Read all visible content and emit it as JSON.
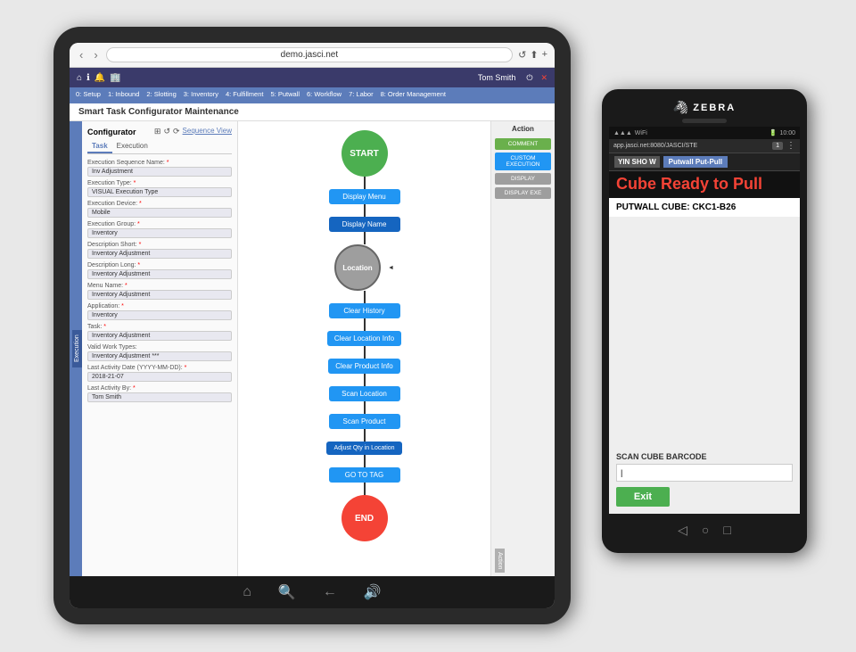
{
  "tablet": {
    "url": "demo.jasci.net",
    "nav_back": "‹",
    "nav_forward": "›",
    "refresh": "↺",
    "share_icon": "⬆",
    "add_icon": "+",
    "user": "Tom Smith",
    "menu_items": [
      "0: Setup",
      "1: Inbound",
      "2: Slotting",
      "3: Inventory",
      "4: Fulfillment",
      "5: Putwall",
      "6: Workflow",
      "7: Labor",
      "8: Order Management"
    ],
    "page_title": "Smart Task Configurator Maintenance",
    "configurator_label": "Configurator",
    "seq_view": "Sequence View",
    "tabs": [
      "Task",
      "Execution"
    ],
    "action_panel_title": "Action",
    "action_buttons": [
      "COMMENT",
      "CUSTOM EXECUTION",
      "DISPLAY",
      "DISPLAY EXE"
    ],
    "side_tab_action": "Action",
    "fields": [
      {
        "label": "Execution Sequence Name:",
        "value": "Inv Adjustment",
        "required": true
      },
      {
        "label": "Execution Type:",
        "value": "VISUAL Execution Type",
        "required": true
      },
      {
        "label": "Execution Device:",
        "value": "Mobile",
        "required": true
      },
      {
        "label": "Execution Group:",
        "value": "Inventory",
        "required": true
      },
      {
        "label": "Description Short:",
        "value": "Inventory Adjustment",
        "required": true
      },
      {
        "label": "Description Long:",
        "value": "Inventory Adjustment",
        "required": true
      },
      {
        "label": "Menu Name:",
        "value": "Inventory Adjustment",
        "required": true
      },
      {
        "label": "Application:",
        "value": "Inventory",
        "required": true
      },
      {
        "label": "Task:",
        "value": "Inventory Adjustment",
        "required": true
      },
      {
        "label": "Valid Work Types:",
        "value": "Inventory Adjustment ***",
        "required": false
      },
      {
        "label": "Last Activity Date (YYYY-MM-DD):",
        "value": "2018-21-07",
        "required": true
      },
      {
        "label": "Last Activity By:",
        "value": "Tom Smith",
        "required": true
      }
    ],
    "flow_nodes": [
      {
        "type": "start",
        "label": "START"
      },
      {
        "type": "box_blue",
        "label": "Display Menu"
      },
      {
        "type": "box_blue2",
        "label": "Display Name"
      },
      {
        "type": "circle_gray",
        "label": "Location"
      },
      {
        "type": "box_blue",
        "label": "Clear History"
      },
      {
        "type": "box_blue",
        "label": "Clear Location Info"
      },
      {
        "type": "box_blue",
        "label": "Clear Product Info"
      },
      {
        "type": "box_blue",
        "label": "Scan Location"
      },
      {
        "type": "box_blue",
        "label": "Scan Product"
      },
      {
        "type": "box_blue2",
        "label": "Adjust Qty in Location"
      },
      {
        "type": "box_blue",
        "label": "GO TO TAG"
      },
      {
        "type": "end",
        "label": "END"
      }
    ]
  },
  "phone": {
    "zebra_brand": "ZEBRA",
    "url": "app.jasci.net:8080/JASCI/STE",
    "page_num": "1",
    "status_time": "10:00",
    "signal": "▲▲▲",
    "wifi": "WiFi",
    "battery": "🔋",
    "user_name": "YIN SHO W",
    "header_title": "Putwall Put-Pull",
    "main_title": "Cube Ready to Pull",
    "putwall_info": "PUTWALL CUBE: CKC1-B26",
    "scan_label": "SCAN CUBE BARCODE",
    "scan_placeholder": "|",
    "exit_btn": "Exit"
  },
  "colors": {
    "green_start": "#4caf50",
    "red_end": "#f44336",
    "blue_flow": "#2196f3",
    "dark_blue_flow": "#1565c0",
    "gray_circle": "#9e9e9e",
    "nav_blue": "#3a3a6a",
    "menu_blue": "#5c7cba",
    "action_green": "#6ab04c"
  }
}
